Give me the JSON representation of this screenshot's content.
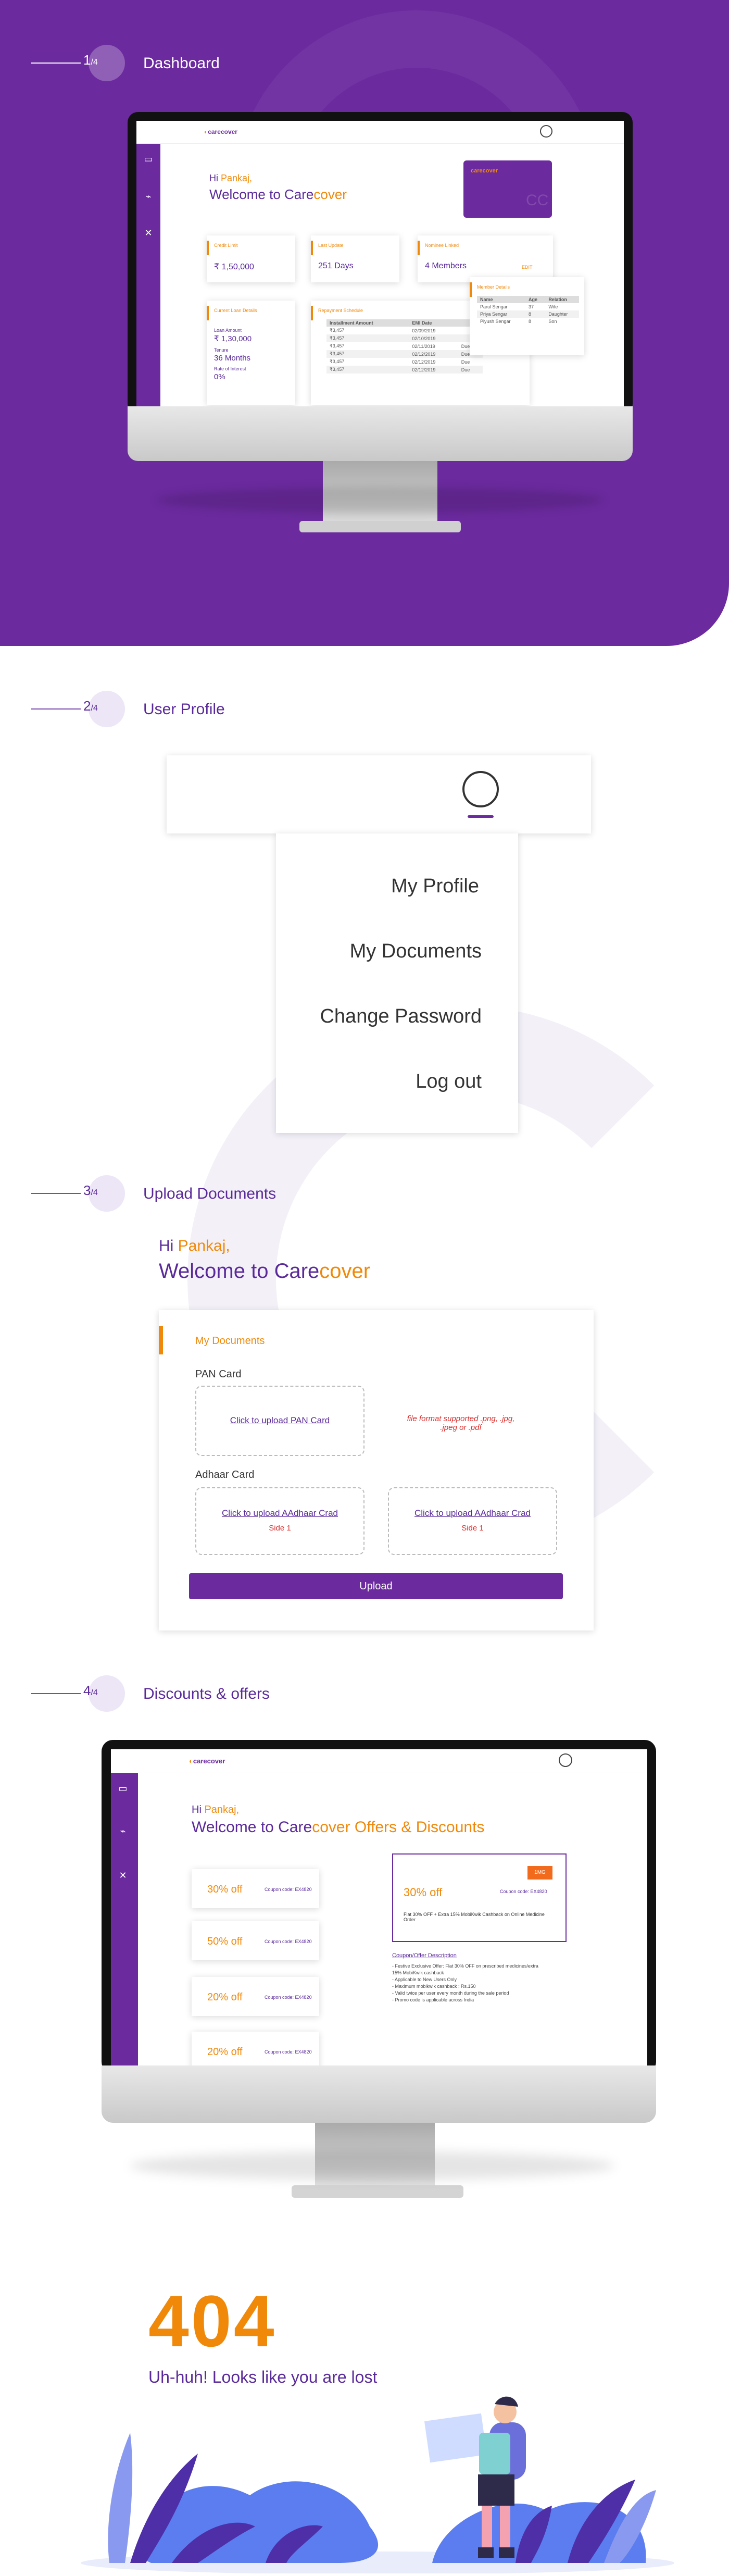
{
  "colors": {
    "purple": "#6b2a9e",
    "orange": "#f0890a",
    "text": "#5a2a9a"
  },
  "steps": [
    {
      "num": "1",
      "den": "/4",
      "title": "Dashboard"
    },
    {
      "num": "2",
      "den": "/4",
      "title": "User Profile"
    },
    {
      "num": "3",
      "den": "/4",
      "title": "Upload Documents"
    },
    {
      "num": "4",
      "den": "/4",
      "title": "Discounts & offers"
    }
  ],
  "dashboard": {
    "logo": "carecover",
    "greet_hi": "Hi ",
    "greet_name": "Pankaj,",
    "welcome_a": "Welcome to Care",
    "welcome_b": "cover",
    "tiles": [
      {
        "label": "Credit Limit",
        "value": "₹ 1,50,000"
      },
      {
        "label": "Last Update",
        "value": "251 Days"
      },
      {
        "label": "Nominee Linked",
        "value": "4 Members",
        "link": "EDIT"
      }
    ],
    "loan": {
      "label": "Current Loan Details",
      "amount_label": "Loan Amount",
      "amount": "₹ 1,30,000",
      "tenure_label": "Tenure",
      "tenure": "36 Months",
      "rate_label": "Rate of Interest",
      "rate": "0%"
    },
    "repay": {
      "label": "Repayment Schedule",
      "col1": "Installment Amount",
      "col2": "EMI Date",
      "rows": [
        [
          "₹3,457",
          "02/09/2019"
        ],
        [
          "₹3,457",
          "02/10/2019"
        ],
        [
          "₹3,457",
          "02/11/2019"
        ],
        [
          "₹3,457",
          "02/12/2019"
        ],
        [
          "₹3,457",
          "02/12/2019"
        ],
        [
          "₹3,457",
          "02/12/2019"
        ]
      ],
      "status": "Due"
    },
    "members": {
      "label": "Member Details",
      "cols": [
        "Name",
        "Age",
        "Relation"
      ],
      "rows": [
        [
          "Parul Sengar",
          "37",
          "Wife"
        ],
        [
          "Priya Sengar",
          "8",
          "Daughter"
        ],
        [
          "Piyush Sengar",
          "8",
          "Son"
        ]
      ]
    }
  },
  "profile_menu": {
    "items": [
      "My Profile",
      "My Documents",
      "Change Password",
      "Log out"
    ]
  },
  "upload": {
    "greet_hi": "Hi ",
    "greet_name": "Pankaj,",
    "welcome_a": "Welcome to Care",
    "welcome_b": "cover",
    "section": "My Documents",
    "pan_label": "PAN Card",
    "pan_link": "Click to upload PAN Card",
    "format_note": "file format supported .png, .jpg, .jpeg or .pdf",
    "aadhaar_label": "Adhaar Card",
    "aadhaar_link": "Click to upload AAdhaar Crad",
    "side1": "Side 1",
    "upload_btn": "Upload"
  },
  "offers": {
    "greet_hi": "Hi ",
    "greet_name": "Pankaj,",
    "welcome_a": "Welcome to Care",
    "welcome_b": "cover Offers & Discounts",
    "list": [
      {
        "pct": "30% off",
        "code": "Coupon code: EX4820"
      },
      {
        "pct": "50% off",
        "code": "Coupon code: EX4820"
      },
      {
        "pct": "20% off",
        "code": "Coupon code: EX4820"
      },
      {
        "pct": "20% off",
        "code": "Coupon code: EX4820"
      }
    ],
    "feature": {
      "pct": "30% off",
      "code": "Coupon code: EX4820",
      "desc": "Flat 30% OFF + Extra 15% MobiKwik Cashback on Online Medicine Order"
    },
    "desc_title": "Coupon/Offer Description",
    "desc_lines": [
      "- Festive Exclusive Offer: Flat 30% OFF on prescribed medicines/extra",
      "  15% MobiKwik cashback",
      "- Applicable to New Users Only",
      "- Maximum mobikwik cashback : Rs.150",
      "- Valid twice per user every month during the sale period",
      "- Promo code is applicable across India"
    ]
  },
  "notfound": {
    "code": "404",
    "message": "Uh-huh! Looks like you are lost"
  }
}
